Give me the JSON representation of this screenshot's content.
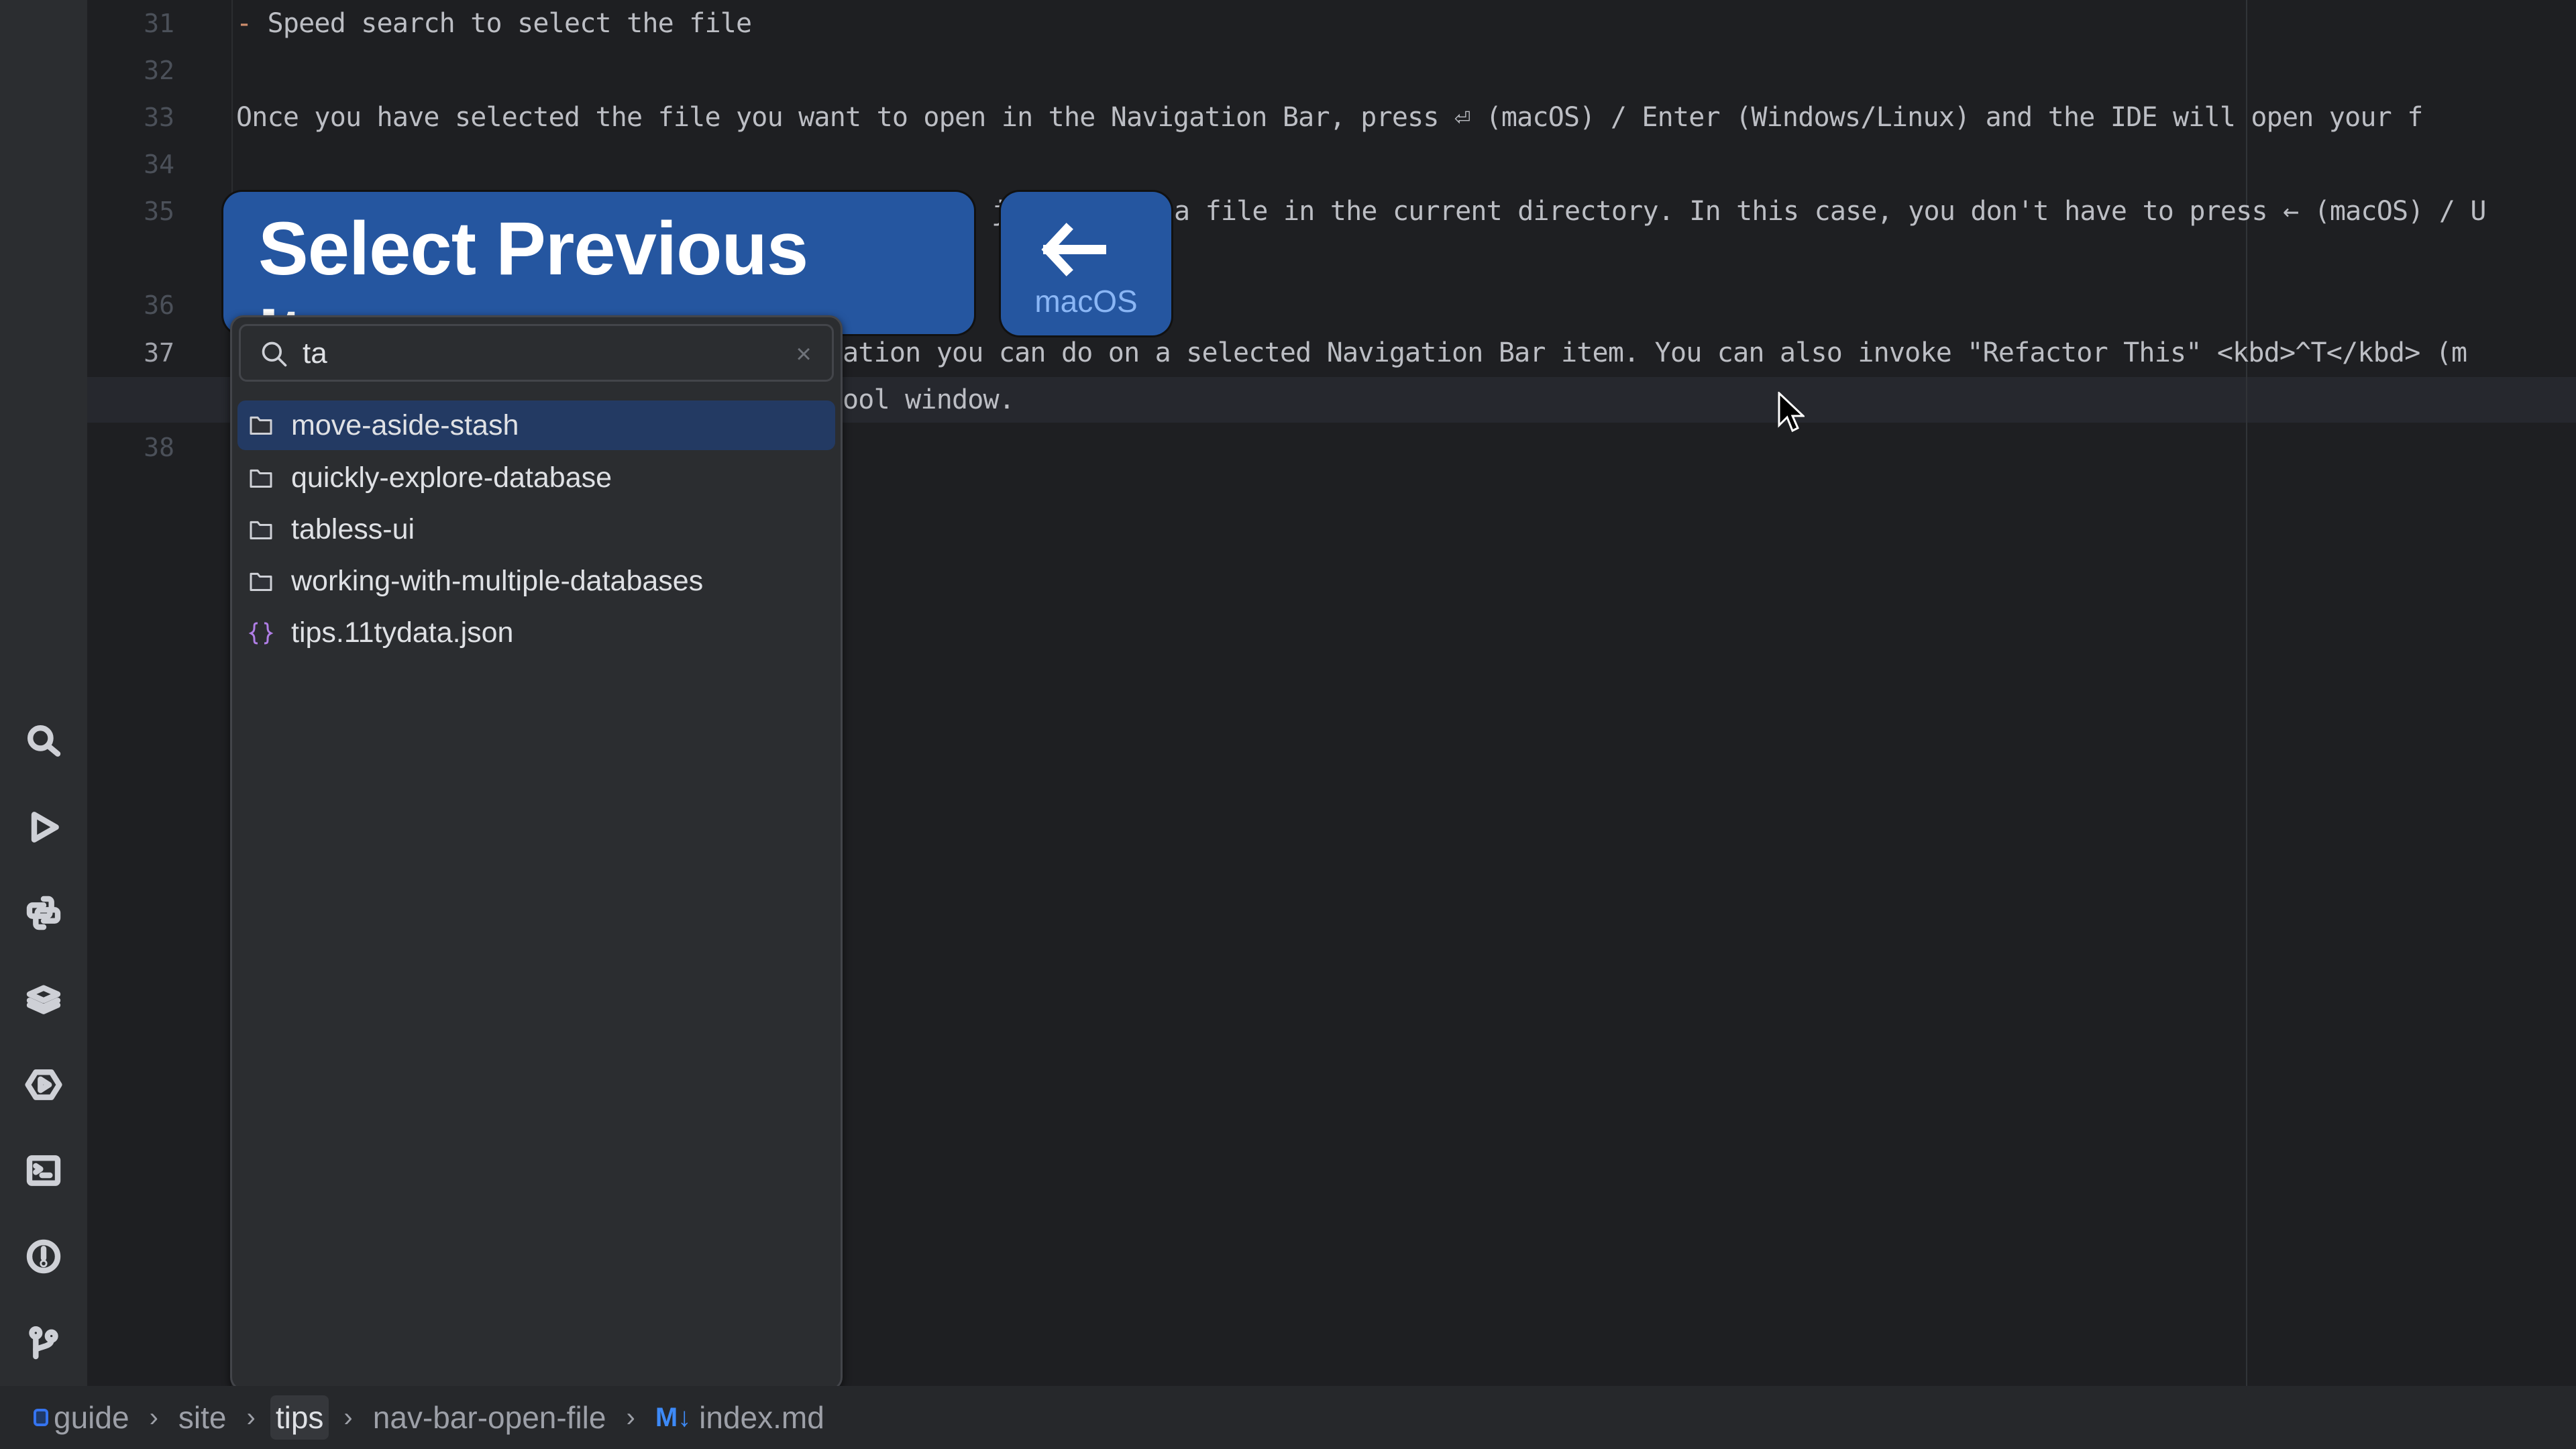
{
  "editor": {
    "lines": [
      {
        "number": "31",
        "text": "- Speed search to select the file",
        "marker": "-",
        "rest": " Speed search to select the file"
      },
      {
        "number": "32",
        "text": ""
      },
      {
        "number": "33",
        "text": "Once you have selected the file you want to open in the Navigation Bar, press ⏎ (macOS) / Enter (Windows/Linux) and the IDE will open your f"
      },
      {
        "number": "34",
        "text": ""
      },
      {
        "number": "35",
        "text": "a file in the current directory. In this case, you don't have to press ← (macOS) / U",
        "partial_prefix": "j"
      },
      {
        "number": "36",
        "text": ""
      },
      {
        "number": "37",
        "text": "ation you can do on a selected Navigation Bar item. You can also invoke \"Refactor This\" <kbd>^T</kbd> (m",
        "wrap": "ool window."
      },
      {
        "number": "38",
        "text": ""
      }
    ],
    "current_line": "37"
  },
  "overlay": {
    "action_title": "Select Previous Item",
    "key_symbol": "←",
    "key_os": "macOS"
  },
  "popup": {
    "search_value": "ta",
    "search_placeholder": "",
    "items": [
      {
        "label": "move-aside-stash",
        "type": "folder",
        "selected": true
      },
      {
        "label": "quickly-explore-database",
        "type": "folder",
        "selected": false
      },
      {
        "label": "tabless-ui",
        "type": "folder",
        "selected": false
      },
      {
        "label": "working-with-multiple-databases",
        "type": "folder",
        "selected": false
      },
      {
        "label": "tips.11tydata.json",
        "type": "json",
        "selected": false
      }
    ]
  },
  "toolstrip": {
    "icons": [
      "search-icon",
      "run-icon",
      "python-console-icon",
      "layers-icon",
      "services-icon",
      "terminal-icon",
      "problems-icon",
      "git-icon"
    ]
  },
  "breadcrumb": {
    "items": [
      {
        "label": "guide",
        "icon": "module-icon"
      },
      {
        "label": "site"
      },
      {
        "label": "tips",
        "active": true
      },
      {
        "label": "nav-bar-open-file"
      },
      {
        "label": "index.md",
        "icon": "markdown-icon",
        "icon_text": "M↓"
      }
    ],
    "separator": "›"
  },
  "colors": {
    "accent": "#2556a0",
    "selection": "#233a63",
    "editor_bg": "#1e1f22",
    "panel_bg": "#2b2d30",
    "json_icon": "#b07ee6"
  }
}
